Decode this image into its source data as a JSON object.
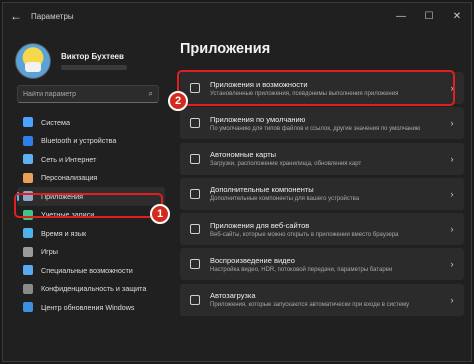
{
  "window": {
    "title": "Параметры",
    "back_glyph": "←",
    "minimize_glyph": "—",
    "maximize_glyph": "☐",
    "close_glyph": "✕"
  },
  "profile": {
    "name": "Виктор Бухтеев"
  },
  "search": {
    "placeholder": "Найти параметр",
    "icon": "search-icon"
  },
  "sidebar": {
    "items": [
      {
        "label": "Система",
        "icon": "monitor-icon",
        "color": "#4aa3ff"
      },
      {
        "label": "Bluetooth и устройства",
        "icon": "bluetooth-icon",
        "color": "#2f7fe8"
      },
      {
        "label": "Сеть и Интернет",
        "icon": "wifi-icon",
        "color": "#5fb0f0"
      },
      {
        "label": "Персонализация",
        "icon": "brush-icon",
        "color": "#e8a15a"
      },
      {
        "label": "Приложения",
        "icon": "apps-icon",
        "color": "#8fa8c8",
        "active": true
      },
      {
        "label": "Учетные записи",
        "icon": "account-icon",
        "color": "#3fc58a"
      },
      {
        "label": "Время и язык",
        "icon": "globe-icon",
        "color": "#4fb2e8"
      },
      {
        "label": "Игры",
        "icon": "gamepad-icon",
        "color": "#9a9a9a"
      },
      {
        "label": "Специальные возможности",
        "icon": "accessibility-icon",
        "color": "#5aa8f0"
      },
      {
        "label": "Конфиденциальность и защита",
        "icon": "shield-icon",
        "color": "#8a8a8a"
      },
      {
        "label": "Центр обновления Windows",
        "icon": "update-icon",
        "color": "#3d8fe0"
      }
    ]
  },
  "main": {
    "title": "Приложения",
    "cards": [
      {
        "title": "Приложения и возможности",
        "subtitle": "Установленные приложения, псевдонимы выполнения приложения",
        "icon": "list-icon"
      },
      {
        "title": "Приложения по умолчанию",
        "subtitle": "По умолчанию для типов файлов и ссылок, другие значения по умолчанию",
        "icon": "default-apps-icon"
      },
      {
        "title": "Автономные карты",
        "subtitle": "Загрузки, расположение хранилища, обновления карт",
        "icon": "map-icon"
      },
      {
        "title": "Дополнительные компоненты",
        "subtitle": "Дополнительные компоненты для вашего устройства",
        "icon": "components-icon"
      },
      {
        "title": "Приложения для веб-сайтов",
        "subtitle": "Веб-сайты, которые можно открыть в приложении вместо браузера",
        "icon": "web-apps-icon"
      },
      {
        "title": "Воспроизведение видео",
        "subtitle": "Настройка видео, HDR, потоковой передачи, параметры батареи",
        "icon": "video-icon"
      },
      {
        "title": "Автозагрузка",
        "subtitle": "Приложения, которые запускаются автоматически при входе в систему",
        "icon": "startup-icon"
      }
    ],
    "chevron": "›"
  },
  "annotations": {
    "step1": "1",
    "step2": "2",
    "highlight_color": "#e02020"
  }
}
